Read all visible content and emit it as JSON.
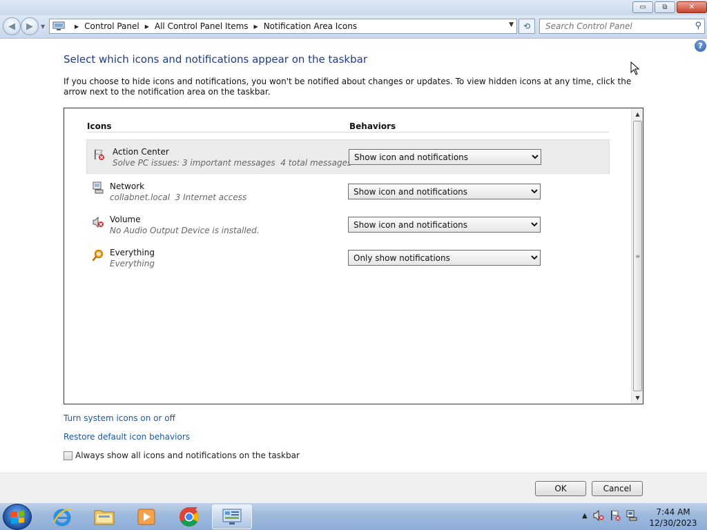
{
  "window": {
    "minimize_glyph": "▭",
    "maximize_glyph": "⧉",
    "close_glyph": "✕"
  },
  "address": {
    "breadcrumbs": [
      "Control Panel",
      "All Control Panel Items",
      "Notification Area Icons"
    ],
    "search_placeholder": "Search Control Panel"
  },
  "help_glyph": "?",
  "page": {
    "title": "Select which icons and notifications appear on the taskbar",
    "intro": "If you choose to hide icons and notifications, you won't be notified about changes or updates. To view hidden icons at any time, click the arrow next to the notification area on the taskbar."
  },
  "table": {
    "col_icons": "Icons",
    "col_behaviors": "Behaviors",
    "rows": [
      {
        "name": "Action Center",
        "description": "Solve PC issues: 3 important messages  4 total messages",
        "behavior": "Show icon and notifications",
        "icon": "action-center-flag-icon"
      },
      {
        "name": "Network",
        "description": "collabnet.local  3 Internet access",
        "behavior": "Show icon and notifications",
        "icon": "network-icon"
      },
      {
        "name": "Volume",
        "description": "No Audio Output Device is installed.",
        "behavior": "Show icon and notifications",
        "icon": "volume-muted-icon"
      },
      {
        "name": "Everything",
        "description": "Everything",
        "behavior": "Only show notifications",
        "icon": "everything-search-icon"
      }
    ]
  },
  "links": {
    "system_icons": "Turn system icons on or off",
    "restore": "Restore default icon behaviors"
  },
  "checkbox": {
    "label": "Always show all icons and notifications on the taskbar",
    "checked": false
  },
  "buttons": {
    "ok": "OK",
    "cancel": "Cancel"
  },
  "taskbar": {
    "time": "7:44 AM",
    "date": "12/30/2023",
    "tray_arrow": "▲"
  },
  "colors": {
    "title": "#1e3a8a",
    "link": "#1a56a5"
  }
}
